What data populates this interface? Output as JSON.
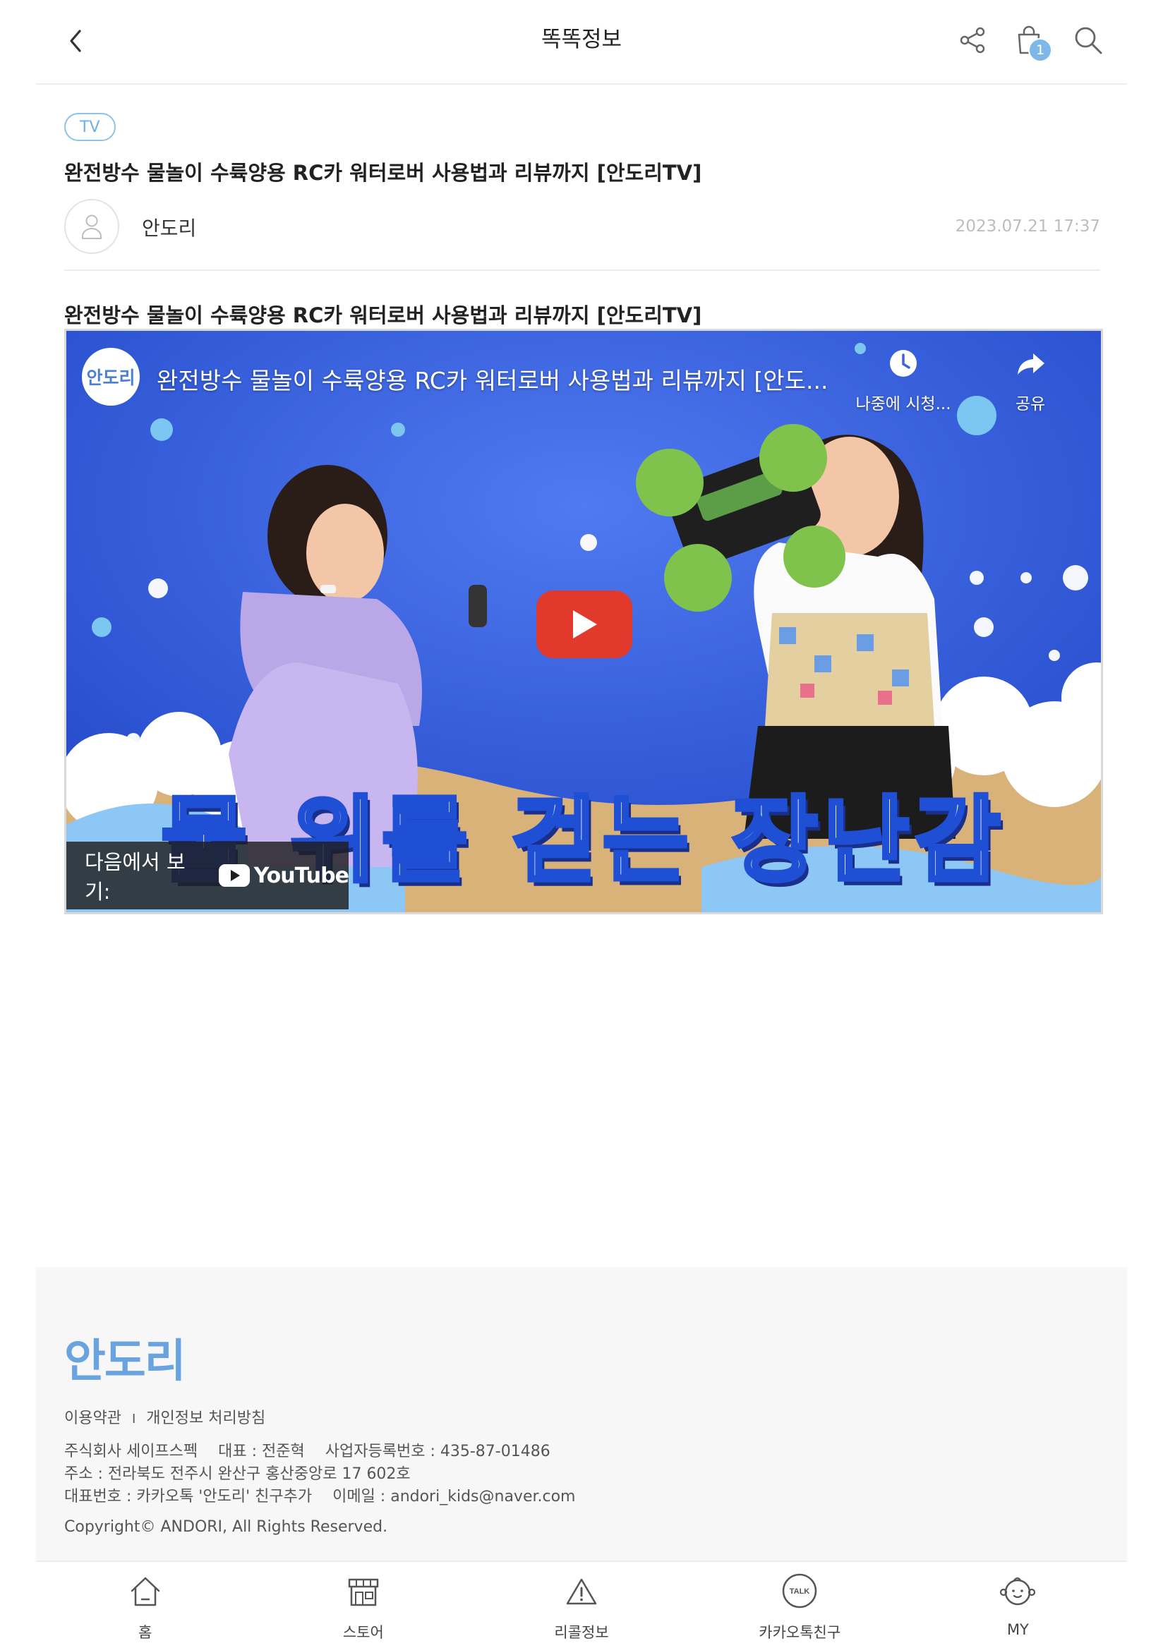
{
  "header": {
    "title": "똑똑정보",
    "cart_count": "1"
  },
  "article": {
    "tag": "TV",
    "title": "완전방수 물놀이 수륙양용 RC카 워터로버 사용법과 리뷰까지 [안도리TV]",
    "author": "안도리",
    "date": "2023.07.21 17:37",
    "body_title": "완전방수 물놀이 수륙양용 RC카 워터로버 사용법과 리뷰까지 [안도리TV]"
  },
  "video": {
    "channel_logo_text": "안도리",
    "title": "완전방수 물놀이 수륙양용 RC카 워터로버 사용법과 리뷰까지 [안도...",
    "watch_later_label": "나중에 시청...",
    "share_label": "공유",
    "watch_on_label": "다음에서 보기:",
    "youtube_brand": "YouTube",
    "thumbnail_caption": "물 위를 걷는 장난감"
  },
  "footer": {
    "logo_text": "안도리",
    "terms_link": "이용약관",
    "links_separator": "I",
    "privacy_link": "개인정보 처리방침",
    "company": "주식회사 세이프스펙",
    "ceo": "대표 : 전준혁",
    "biz_number": "사업자등록번호 : 435-87-01486",
    "address": "주소 : 전라북도 전주시 완산구 홍산중앙로 17 602호",
    "contact": "대표번호 : 카카오톡 '안도리' 친구추가",
    "email": "이메일 : andori_kids@naver.com",
    "copyright": "Copyright© ANDORI, All Rights Reserved."
  },
  "bottom_nav": {
    "home": "홈",
    "store": "스토어",
    "recall": "리콜정보",
    "kakao": "카카오톡친구",
    "my": "MY"
  },
  "colors": {
    "accent": "#6cb0e4",
    "badge": "#7db8e8",
    "video_bg": "#3b63e6",
    "play_button": "#e1392b"
  }
}
